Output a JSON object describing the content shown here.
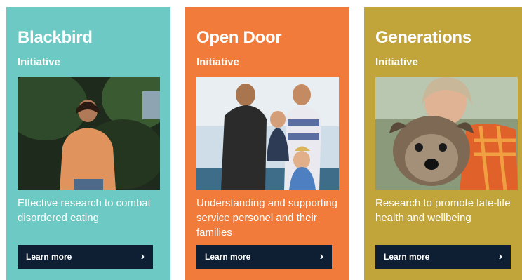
{
  "cards": [
    {
      "title": "Blackbird",
      "subtitle": "Initiative",
      "description": "Effective research to combat disordered eating",
      "button_label": "Learn more",
      "button_icon": "chevron-right-icon",
      "color": "#6cc9c3"
    },
    {
      "title": "Open Door",
      "subtitle": "Initiative",
      "description": "Understanding and supporting service personel and their families",
      "button_label": "Learn more",
      "button_icon": "chevron-right-icon",
      "color": "#f07b3a"
    },
    {
      "title": "Generations",
      "subtitle": "Initiative",
      "description": "Research to promote late-life health and wellbeing",
      "button_label": "Learn more",
      "button_icon": "chevron-right-icon",
      "color": "#c1a43a"
    }
  ],
  "colors": {
    "button_bg": "#0e1e33",
    "text": "#ffffff"
  }
}
